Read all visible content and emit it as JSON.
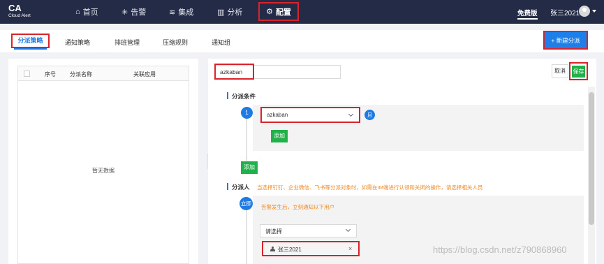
{
  "brand": {
    "name": "CA",
    "subtitle": "Cloud Alert"
  },
  "nav": {
    "home": "首页",
    "alarm": "告警",
    "integration": "集成",
    "analysis": "分析",
    "config": "配置"
  },
  "header": {
    "edition": "免费版",
    "user": "张三2021"
  },
  "tabs": {
    "dispatch_policy": "分派策略",
    "notify_policy": "通知策略",
    "schedule": "排班管理",
    "compress": "压缩规则",
    "notify_group": "通知组"
  },
  "new_button": "+ 新建分派",
  "table": {
    "columns": {
      "seq": "序号",
      "name": "分派名称",
      "app": "关联应用"
    },
    "empty": "暂无数据"
  },
  "editor": {
    "name_value": "azkaban",
    "cancel": "取消",
    "save": "保存",
    "conditions_title": "分派条件",
    "condition_index": "1",
    "condition_app": "azkaban",
    "condition_tag": "且",
    "add_inner": "添加",
    "add_outer": "添加",
    "assignee_title": "分派人",
    "assignee_hint": "当选择钉钉、企业微信、飞书等分派对象时，如需在IM端进行认领和关闭的操作，请选择相关人员",
    "immediate_tag": "立即",
    "immediate_hint": "告警发生后，立刻通知以下用户",
    "select_placeholder": "请选择",
    "chip_user": "张三2021",
    "chip_remove": "×"
  },
  "watermark": "https://blog.csdn.net/z790868960",
  "colors": {
    "primary": "#1e7be5",
    "success": "#21b14a",
    "highlight": "#d8232a",
    "topbar": "#232b47",
    "hint": "#f08a24"
  },
  "icons": [
    "home-icon",
    "alarm-icon",
    "layers-icon",
    "chart-icon",
    "gear-icon",
    "user-icon",
    "collapse-icon"
  ]
}
